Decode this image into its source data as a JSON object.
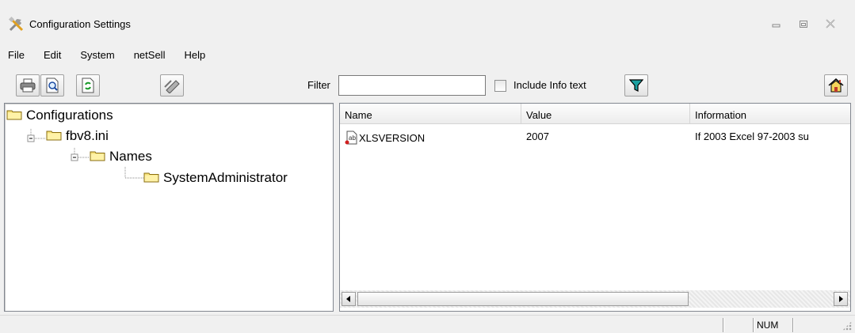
{
  "window": {
    "title": "Configuration Settings",
    "controls": [
      "minimize",
      "restore",
      "close"
    ]
  },
  "menu": [
    "File",
    "Edit",
    "System",
    "netSell",
    "Help"
  ],
  "toolbar": {
    "buttons": [
      "print-icon",
      "print-preview-icon",
      "refresh-icon",
      "unknown-tool-icon"
    ],
    "filter_label": "Filter",
    "filter_value": "",
    "include_info_label": "Include Info text",
    "include_info_checked": false,
    "filter_button_icon": "filter-funnel-icon",
    "home_button_icon": "home-icon"
  },
  "tree": {
    "nodes": [
      {
        "label": "Configurations",
        "level": 0
      },
      {
        "label": "fbv8.ini",
        "level": 1
      },
      {
        "label": "Names",
        "level": 2
      },
      {
        "label": "SystemAdministrator",
        "level": 3
      }
    ]
  },
  "list": {
    "columns": [
      "Name",
      "Value",
      "Information"
    ],
    "rows": [
      {
        "name": "XLSVERSION",
        "value": "2007",
        "information": "If 2003 Excel 97-2003 su"
      }
    ]
  },
  "statusbar": {
    "num": "NUM"
  },
  "colors": {
    "folder_fill": "#f7e27a",
    "filter_funnel": "#1aa0a0",
    "window_bg": "#f0f0f0"
  }
}
